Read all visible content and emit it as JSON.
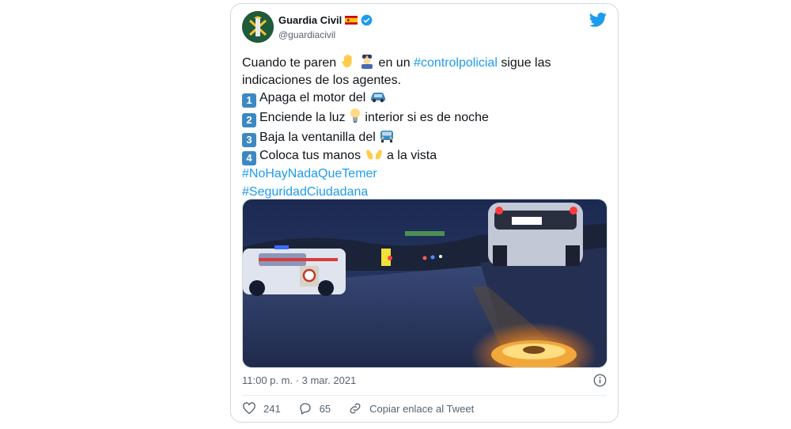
{
  "author": {
    "display_name": "Guardia Civil",
    "handle": "@guardiacivil",
    "flag_icon": "spain-flag-icon",
    "verified_icon": "verified-badge-icon"
  },
  "brand": {
    "logo_icon": "twitter-bird-icon",
    "accent": "#1d9bf0"
  },
  "tweet": {
    "line1_before": "Cuando te paren ",
    "line1_mid": " en un ",
    "line1_hashtag": "#controlpolicial",
    "line1_after": " sigue las",
    "line2": "indicaciones de los agentes.",
    "steps": [
      {
        "num": "1",
        "text_before": "Apaga el motor del ",
        "text_after": ""
      },
      {
        "num": "2",
        "text_before": "Enciende la luz ",
        "text_after": " interior si es de noche"
      },
      {
        "num": "3",
        "text_before": "Baja la ventanilla del ",
        "text_after": ""
      },
      {
        "num": "4",
        "text_before": "Coloca tus manos ",
        "text_after": " a la vista"
      }
    ],
    "hashtag1": "#NoHayNadaQueTemer",
    "hashtag2": "#SeguridadCiudadana"
  },
  "media": {
    "image_alt_icon": "night-road-checkpoint-photo"
  },
  "meta": {
    "timestamp": "11:00 p. m. · 3 mar. 2021",
    "info_icon": "info-icon"
  },
  "actions": {
    "likes": "241",
    "replies": "65",
    "copy_link_label": "Copiar enlace al Tweet"
  }
}
